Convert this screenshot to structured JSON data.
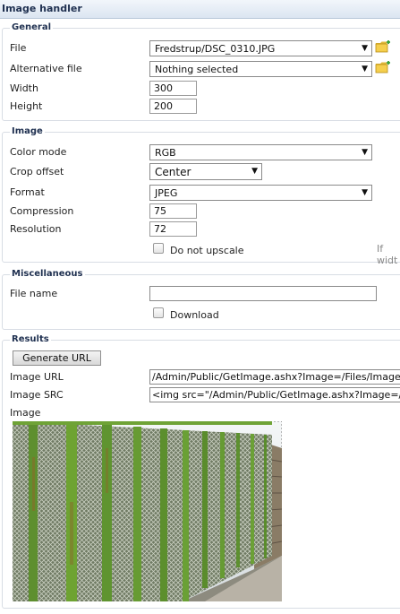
{
  "panel_title": "Image handler",
  "general": {
    "legend": "General",
    "file_label": "File",
    "file_value": "Fredstrup/DSC_0310.JPG",
    "alt_file_label": "Alternative file",
    "alt_file_value": "Nothing selected",
    "width_label": "Width",
    "width_value": "300",
    "height_label": "Height",
    "height_value": "200"
  },
  "image": {
    "legend": "Image",
    "color_mode_label": "Color mode",
    "color_mode_value": "RGB",
    "crop_offset_label": "Crop offset",
    "crop_offset_value": "Center",
    "format_label": "Format",
    "format_value": "JPEG",
    "compression_label": "Compression",
    "compression_value": "75",
    "resolution_label": "Resolution",
    "resolution_value": "72",
    "no_upscale_label": "Do not upscale",
    "hint_text": "If widt"
  },
  "misc": {
    "legend": "Miscellaneous",
    "file_name_label": "File name",
    "file_name_value": "",
    "download_label": "Download"
  },
  "results": {
    "legend": "Results",
    "generate_label": "Generate URL",
    "image_url_label": "Image URL",
    "image_url_value": "/Admin/Public/GetImage.ashx?Image=/Files/Images/Fredstrup",
    "image_src_label": "Image SRC",
    "image_src_value": "<img src=\"/Admin/Public/GetImage.ashx?Image=/Files/Images",
    "image_label": "Image"
  },
  "icons": {
    "dropdown": "chevron-down-icon",
    "folder": "folder-icon"
  },
  "colors": {
    "title_text": "#1f3050",
    "border": "#d8dde4"
  }
}
